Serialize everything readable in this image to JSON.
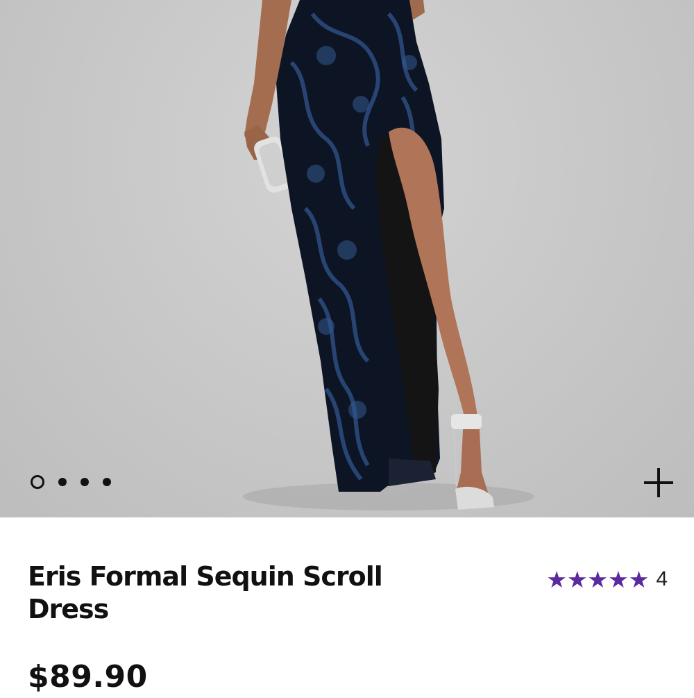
{
  "product": {
    "title": "Eris Formal Sequin Scroll Dress",
    "price": "$89.90",
    "rating": {
      "stars": 5,
      "review_count": "4",
      "star_color": "#5b2a9e"
    }
  },
  "gallery": {
    "image_count": 4,
    "active_index": 0,
    "zoom_icon": "plus-icon"
  }
}
